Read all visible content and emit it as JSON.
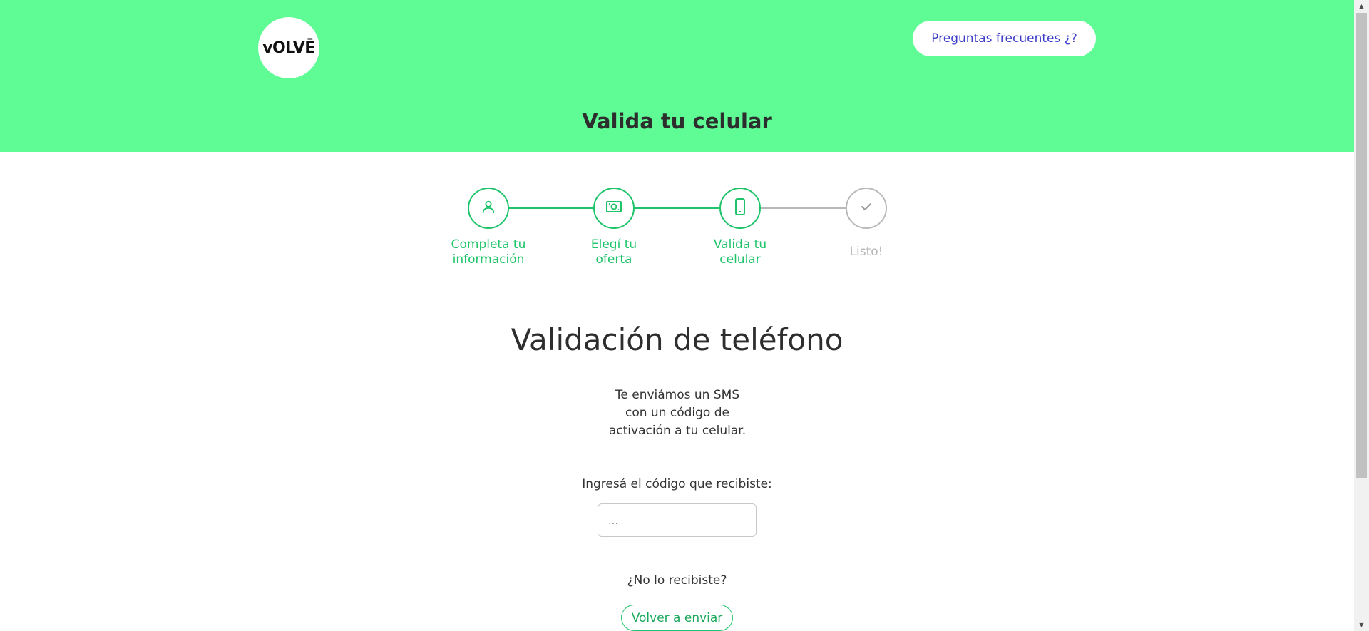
{
  "header": {
    "logo_text": "vOLVĒ",
    "faq_button": "Preguntas frecuentes ¿?",
    "title": "Valida tu celular",
    "background_color": "#5ffc96"
  },
  "stepper": {
    "steps": [
      {
        "label_line1": "Completa tu",
        "label_line2": "información",
        "icon": "user-icon",
        "status": "completed"
      },
      {
        "label_line1": "Elegí tu",
        "label_line2": "oferta",
        "icon": "money-icon",
        "status": "completed"
      },
      {
        "label_line1": "Valida tu",
        "label_line2": "celular",
        "icon": "phone-icon",
        "status": "active"
      },
      {
        "label_line1": "Listo!",
        "label_line2": "",
        "icon": "check-icon",
        "status": "pending"
      }
    ],
    "active_color": "#1fc46a",
    "pending_color": "#b9b9b9"
  },
  "main": {
    "title": "Validación de teléfono",
    "desc_line1": "Te enviámos un SMS",
    "desc_line2": "con un código de",
    "desc_line3": "activación a tu celular.",
    "code_label": "Ingresá el código que recibiste:",
    "code_placeholder": "...",
    "code_value": "",
    "no_receive": "¿No lo recibiste?",
    "resend_button": "Volver a enviar"
  }
}
